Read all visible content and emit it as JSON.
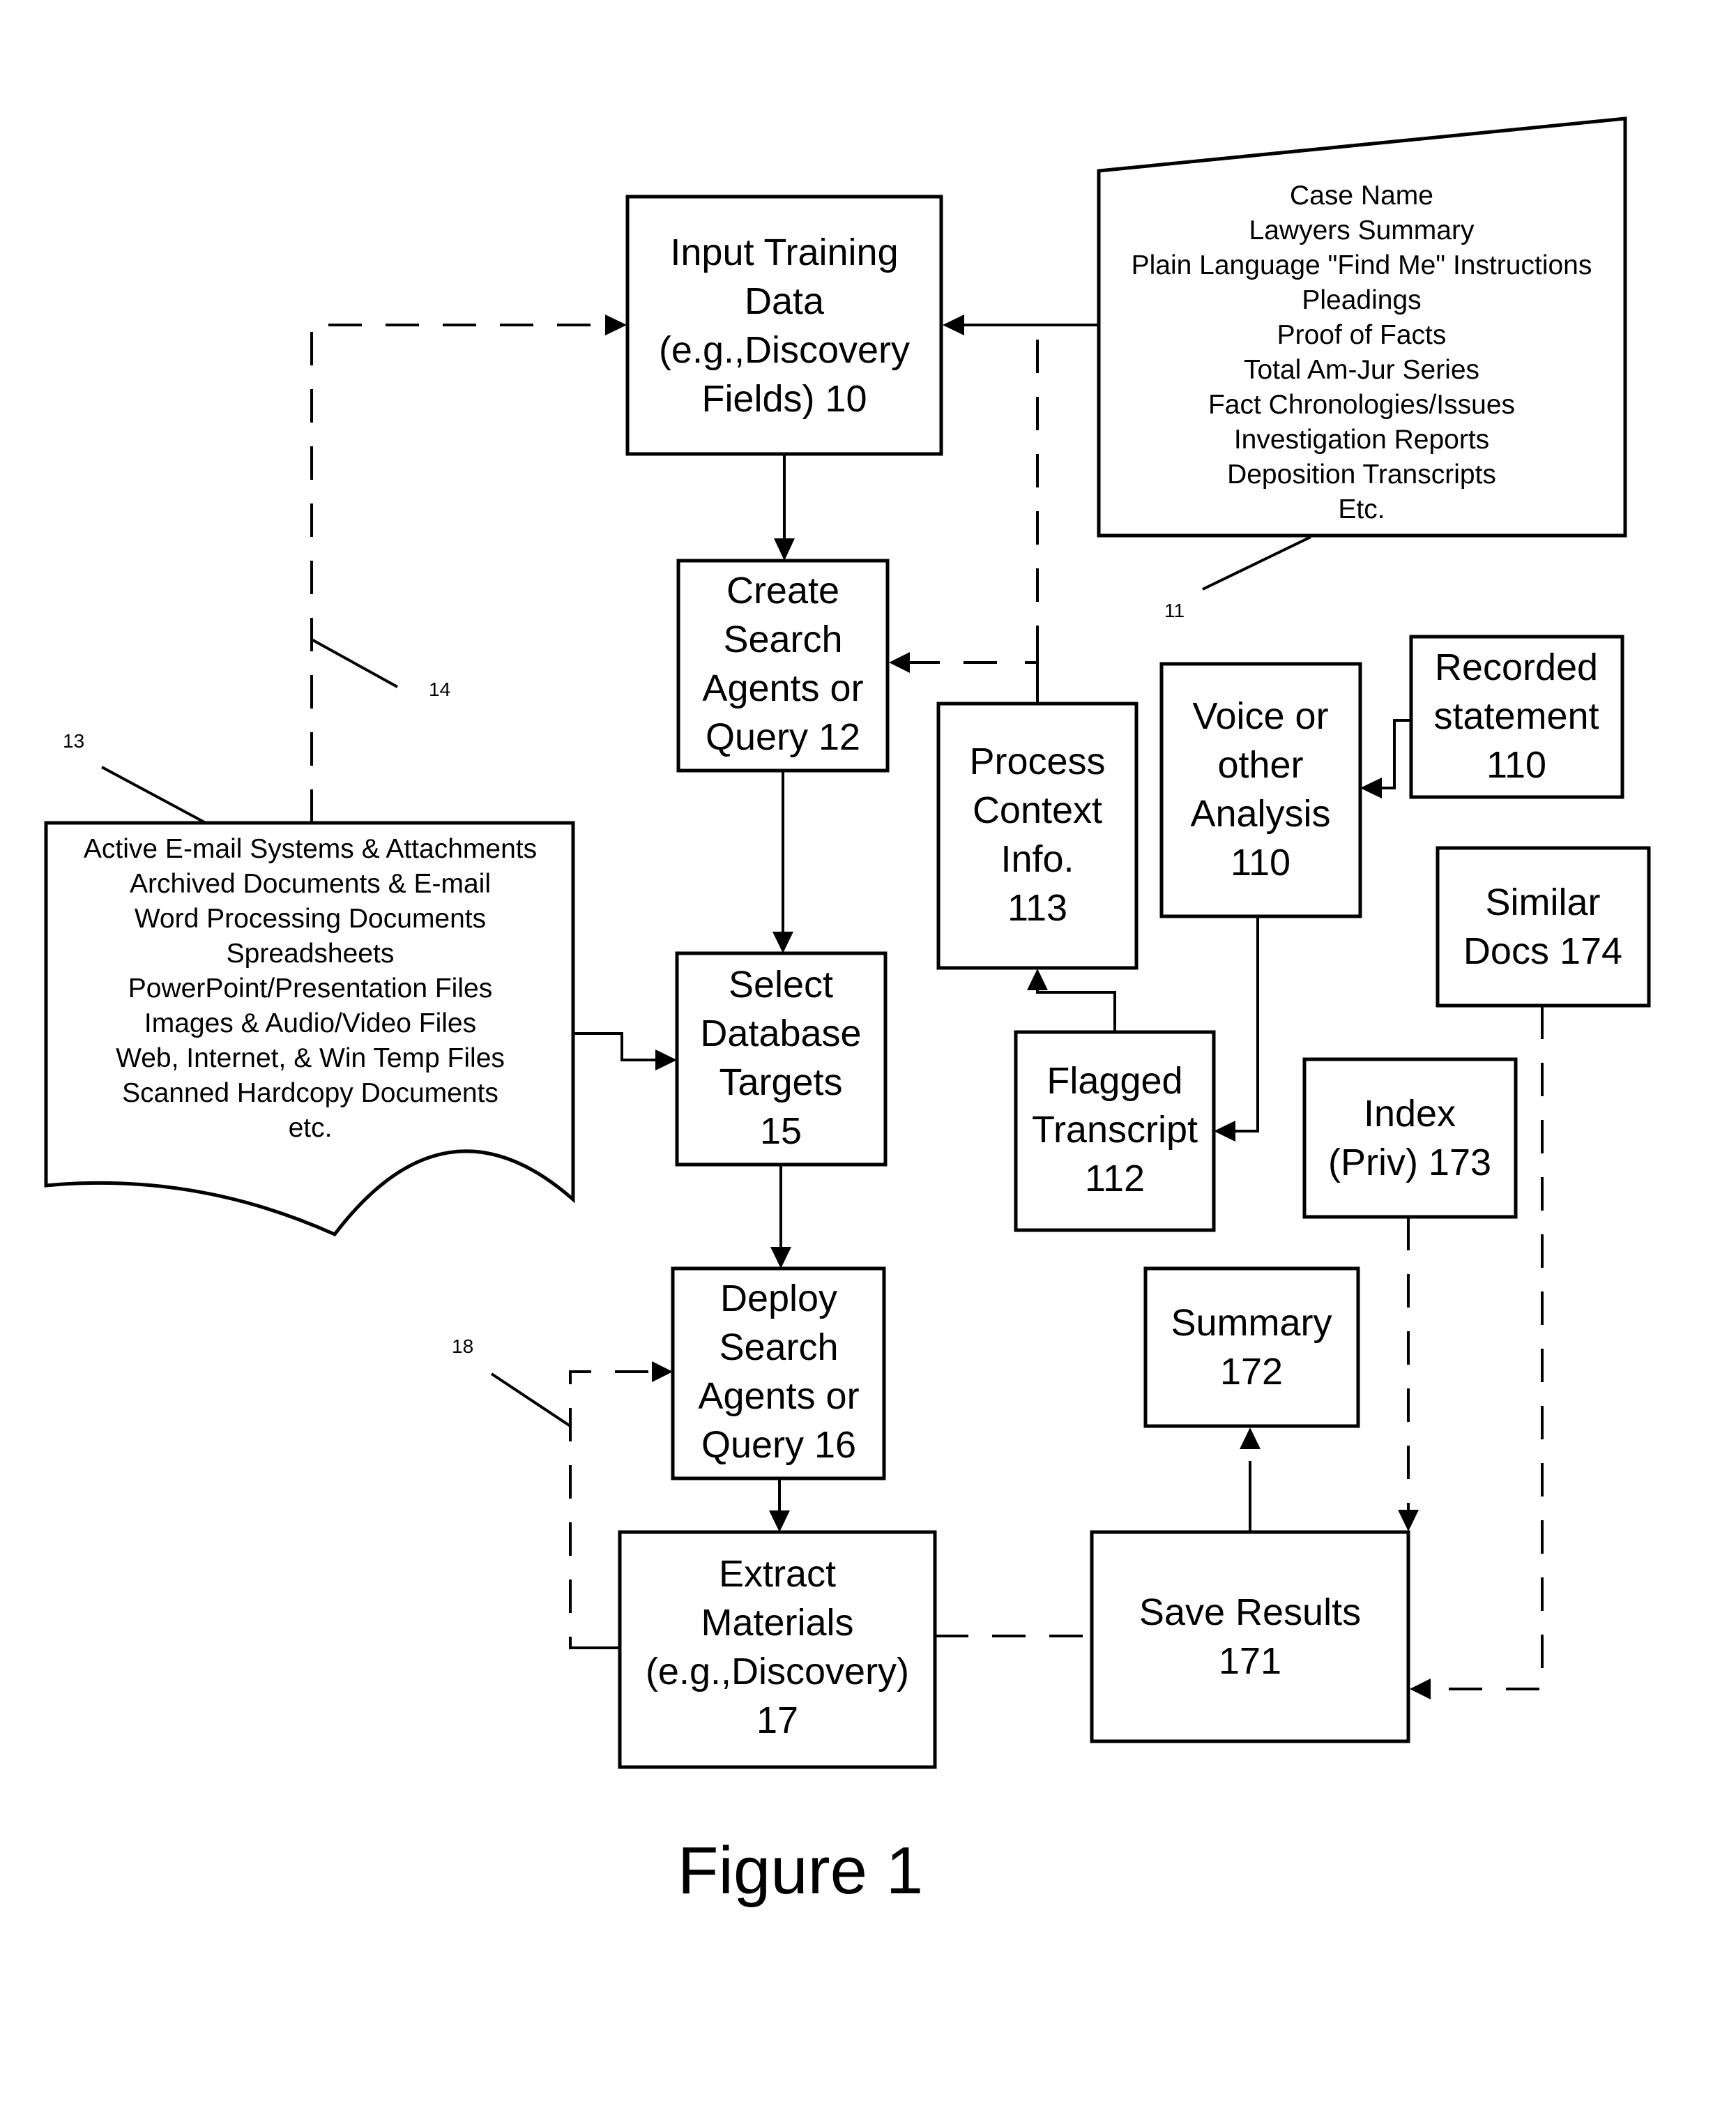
{
  "figure_title": "Figure 1",
  "boxes": {
    "b10": [
      "Input Training",
      "Data",
      "(e.g.,Discovery",
      "Fields) 10"
    ],
    "b12": [
      "Create",
      "Search",
      "Agents or",
      "Query 12"
    ],
    "b15": [
      "Select",
      "Database",
      "Targets",
      "15"
    ],
    "b16": [
      "Deploy",
      "Search",
      "Agents or",
      "Query 16"
    ],
    "b17": [
      "Extract",
      "Materials",
      "(e.g.,Discovery)",
      "17"
    ],
    "b171": [
      "Save Results",
      "171"
    ],
    "b172": [
      "Summary",
      "172"
    ],
    "b173": [
      "Index",
      "(Priv) 173"
    ],
    "b174": [
      "Similar",
      "Docs 174"
    ],
    "b112": [
      "Flagged",
      "Transcript",
      "112"
    ],
    "b113": [
      "Process",
      "Context",
      "Info.",
      "113"
    ],
    "b110a": [
      "Voice or",
      "other",
      "Analysis",
      "110"
    ],
    "b110b": [
      "Recorded",
      "statement",
      "110"
    ]
  },
  "doc11": [
    "Case Name",
    "Lawyers Summary",
    "Plain Language \"Find Me\" Instructions",
    "Pleadings",
    "Proof of Facts",
    "Total Am-Jur Series",
    "Fact Chronologies/Issues",
    "Investigation Reports",
    "Deposition Transcripts",
    "Etc."
  ],
  "doc13": [
    "Active E-mail Systems & Attachments",
    "Archived Documents & E-mail",
    "Word Processing Documents",
    "Spreadsheets",
    "PowerPoint/Presentation Files",
    "Images & Audio/Video Files",
    "Web, Internet, & Win Temp Files",
    "Scanned Hardcopy Documents",
    "etc."
  ],
  "refs": {
    "r11": "11",
    "r13": "13",
    "r14": "14",
    "r18": "18"
  }
}
